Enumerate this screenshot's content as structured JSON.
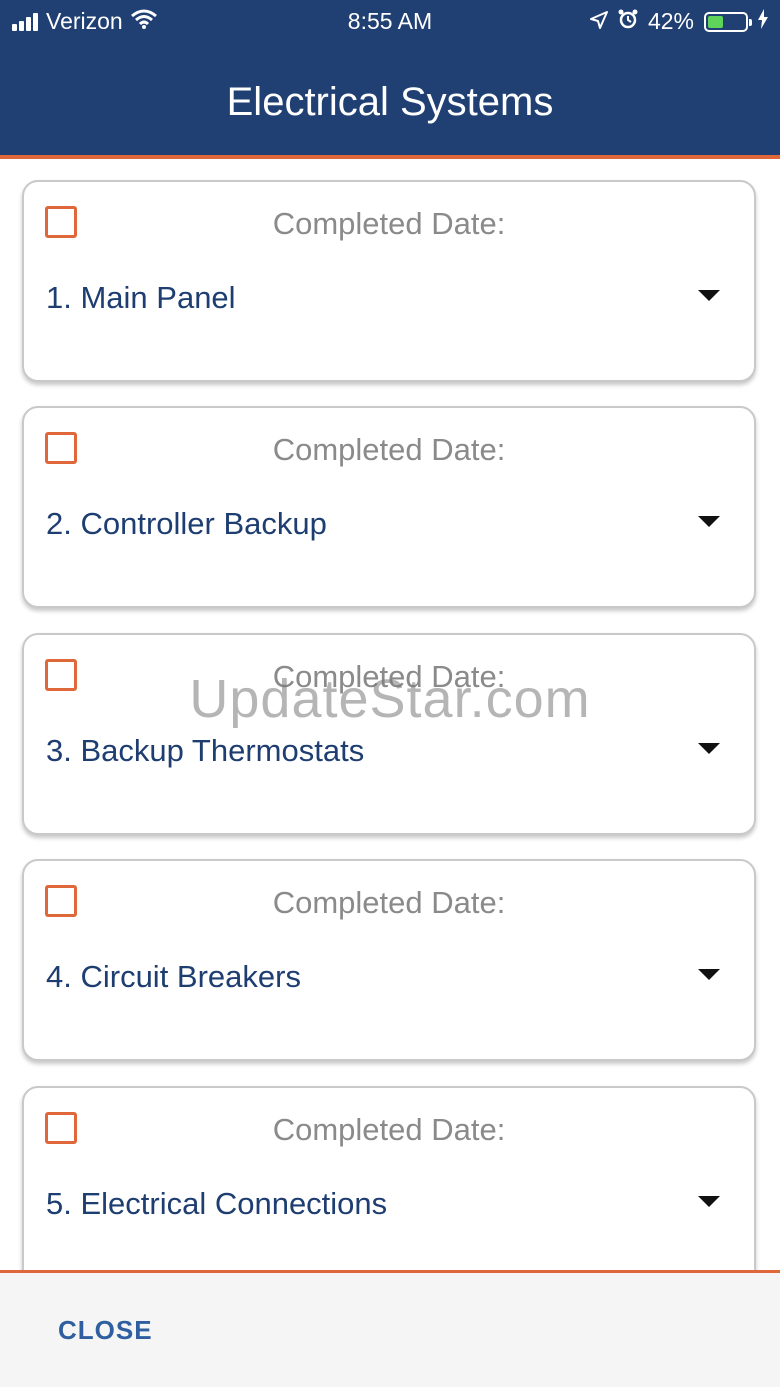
{
  "status_bar": {
    "carrier": "Verizon",
    "time": "8:55 AM",
    "battery_percent": "42%",
    "battery_level": 0.42,
    "icons": [
      "signal-icon",
      "wifi-icon",
      "location-icon",
      "alarm-icon",
      "battery-icon",
      "charging-icon"
    ]
  },
  "header": {
    "title": "Electrical Systems"
  },
  "items": [
    {
      "completed_label": "Completed Date:",
      "title": "1. Main Panel",
      "checked": false
    },
    {
      "completed_label": "Completed Date:",
      "title": "2. Controller Backup",
      "checked": false
    },
    {
      "completed_label": "Completed Date:",
      "title": "3. Backup Thermostats",
      "checked": false
    },
    {
      "completed_label": "Completed Date:",
      "title": "4. Circuit Breakers",
      "checked": false
    },
    {
      "completed_label": "Completed Date:",
      "title": "5. Electrical Connections",
      "checked": false
    }
  ],
  "watermark": "UpdateStar.com",
  "footer": {
    "close_label": "CLOSE"
  },
  "colors": {
    "header_bg": "#203f73",
    "accent": "#e0673a",
    "item_title": "#1e3d70",
    "close_text": "#2f5fa0"
  }
}
